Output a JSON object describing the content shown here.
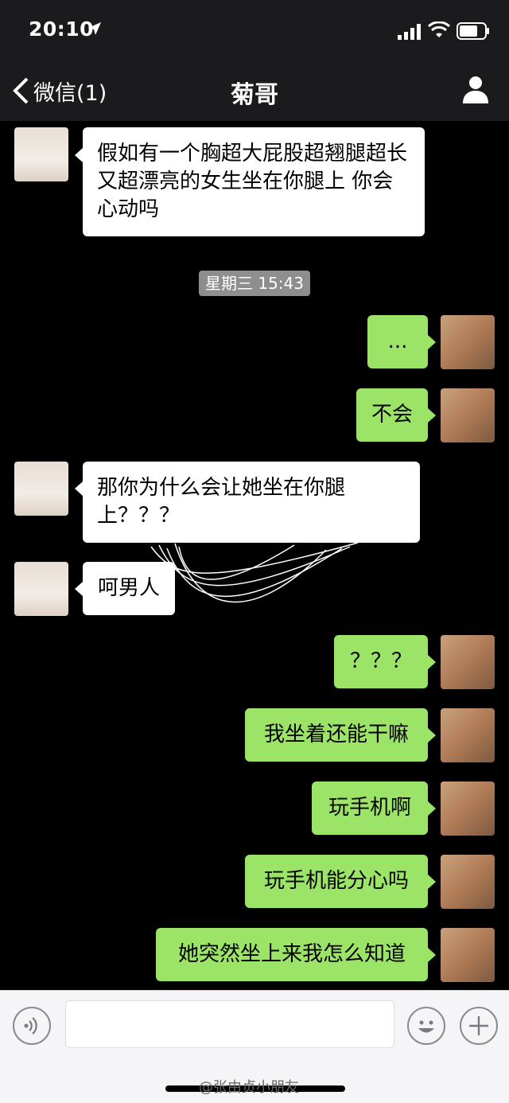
{
  "status_bar": {
    "time": "20:10"
  },
  "nav": {
    "back_label": "微信(1)",
    "title": "菊哥"
  },
  "messages": [
    {
      "from": "other",
      "text": "假如有一个胸超大屁股超翘腿超长又超漂亮的女生坐在你腿上 你会心动吗"
    },
    {
      "from": "me",
      "text": "..."
    },
    {
      "from": "me",
      "text": "不会"
    },
    {
      "from": "other",
      "text": "那你为什么会让她坐在你腿上？？？"
    },
    {
      "from": "other",
      "text": "呵男人"
    },
    {
      "from": "me",
      "text": "？？？"
    },
    {
      "from": "me",
      "text": "我坐着还能干嘛"
    },
    {
      "from": "me",
      "text": "玩手机啊"
    },
    {
      "from": "me",
      "text": "玩手机能分心吗"
    },
    {
      "from": "me",
      "text": "她突然坐上来我怎么知道"
    }
  ],
  "timestamp": "星期三 15:43",
  "watermark": "@张由贞小朋友",
  "colors": {
    "bubble_me": "#9ce468",
    "bubble_other": "#ffffff",
    "background": "#000000",
    "nav_bg": "#1b1b1d"
  }
}
